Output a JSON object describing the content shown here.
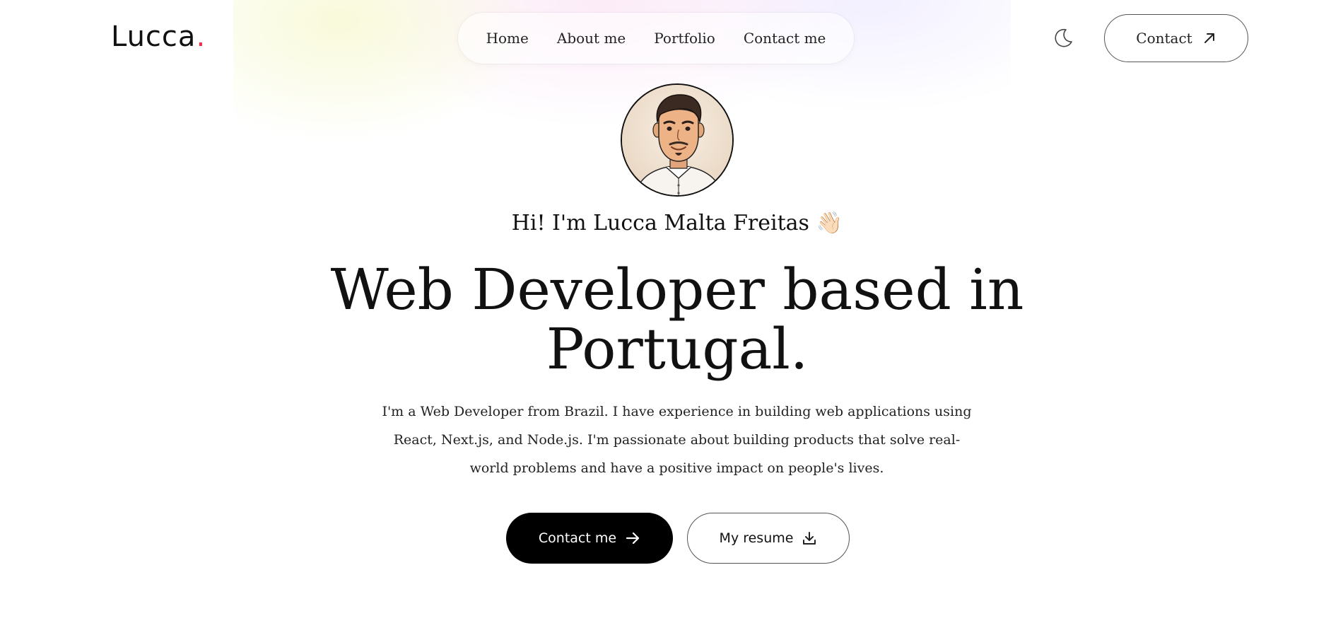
{
  "brand": {
    "name": "Lucca",
    "dot": ".",
    "accent_color": "#e8304a"
  },
  "nav": {
    "items": [
      {
        "label": "Home"
      },
      {
        "label": "About me"
      },
      {
        "label": "Portfolio"
      },
      {
        "label": "Contact me"
      }
    ]
  },
  "header": {
    "theme_toggle_icon": "moon-icon",
    "contact_label": "Contact",
    "contact_icon": "arrow-up-right-icon"
  },
  "hero": {
    "avatar_icon": "avatar-illustration",
    "greeting": "Hi! I'm Lucca Malta Freitas",
    "greeting_emoji": "👋🏻",
    "headline_line1": "Web Developer based in",
    "headline_line2": "Portugal.",
    "bio": "I'm a Web Developer from Brazil. I have experience in building web applications using React, Next.js, and Node.js. I'm passionate about building products that solve real-world problems and have a positive impact on people's lives.",
    "primary_button": {
      "label": "Contact me",
      "icon": "arrow-right-icon"
    },
    "secondary_button": {
      "label": "My resume",
      "icon": "download-icon"
    }
  }
}
